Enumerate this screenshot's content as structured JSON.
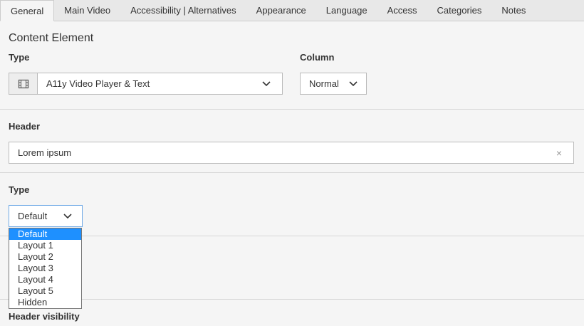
{
  "tabs": [
    {
      "label": "General"
    },
    {
      "label": "Main Video"
    },
    {
      "label": "Accessibility | Alternatives"
    },
    {
      "label": "Appearance"
    },
    {
      "label": "Language"
    },
    {
      "label": "Access"
    },
    {
      "label": "Categories"
    },
    {
      "label": "Notes"
    }
  ],
  "content_element": {
    "title": "Content Element",
    "type_label": "Type",
    "type_value": "A11y Video Player & Text",
    "column_label": "Column",
    "column_value": "Normal"
  },
  "header": {
    "label": "Header",
    "value": "Lorem ipsum",
    "clear_glyph": "×"
  },
  "layout_type": {
    "label": "Type",
    "value": "Default",
    "options": [
      "Default",
      "Layout 1",
      "Layout 2",
      "Layout 3",
      "Layout 4",
      "Layout 5",
      "Hidden"
    ],
    "selected_index": 0
  },
  "header_visibility": {
    "label": "Header visibility"
  },
  "icons": {
    "ctype": "film-icon",
    "chevron": "chevron-down-icon"
  }
}
